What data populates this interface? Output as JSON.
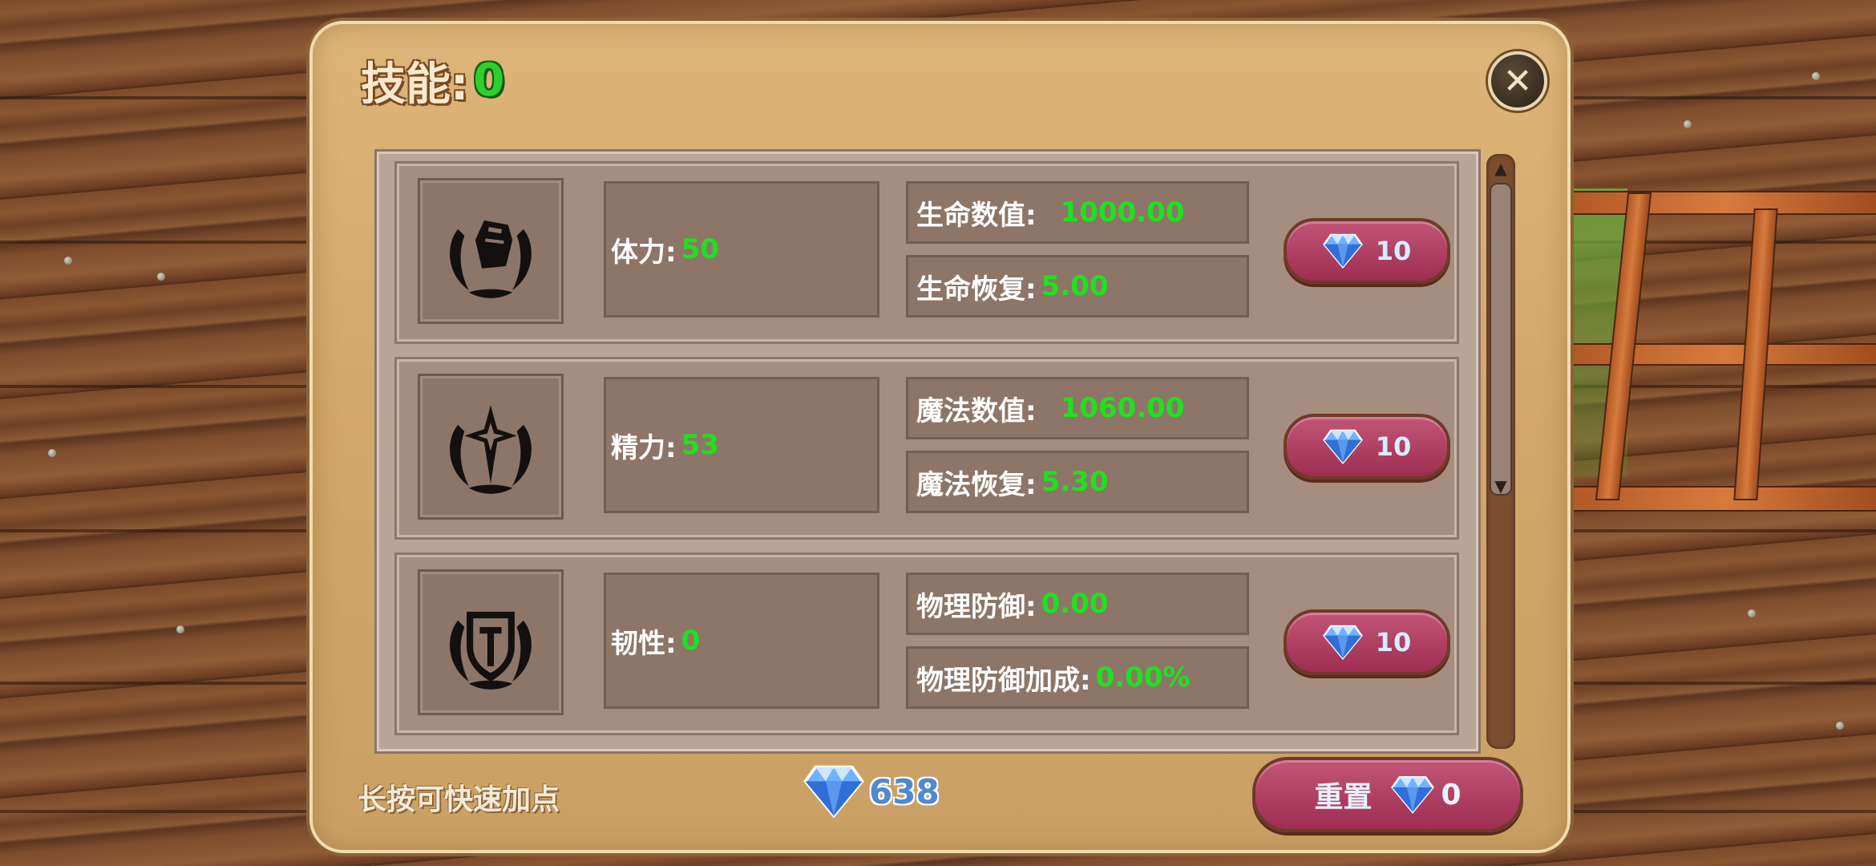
{
  "header": {
    "title": "技能:",
    "skill_points": "0"
  },
  "close_button": {
    "symbol": "✕"
  },
  "skills": [
    {
      "icon": "fist-emblem-icon",
      "attribute_label": "体力:",
      "attribute_value": "50",
      "stats": [
        {
          "label": "生命数值:",
          "value": "1000.00"
        },
        {
          "label": "生命恢复:",
          "value": "5.00"
        }
      ],
      "cost": "10"
    },
    {
      "icon": "star-emblem-icon",
      "attribute_label": "精力:",
      "attribute_value": "53",
      "stats": [
        {
          "label": "魔法数值:",
          "value": "1060.00"
        },
        {
          "label": "魔法恢复:",
          "value": "5.30"
        }
      ],
      "cost": "10"
    },
    {
      "icon": "shield-emblem-icon",
      "attribute_label": "韧性:",
      "attribute_value": "0",
      "stats": [
        {
          "label": "物理防御:",
          "value": "0.00"
        },
        {
          "label": "物理防御加成:",
          "value": "0.00%"
        }
      ],
      "cost": "10"
    }
  ],
  "footer": {
    "hint": "长按可快速加点",
    "gem_total": "638",
    "reset_label": "重置",
    "reset_cost": "0"
  },
  "colors": {
    "highlight_green": "#1fe01f",
    "gem_blue": "#4f8ad0",
    "button_magenta": "#b03f63",
    "panel_tan": "#d3a66a"
  }
}
